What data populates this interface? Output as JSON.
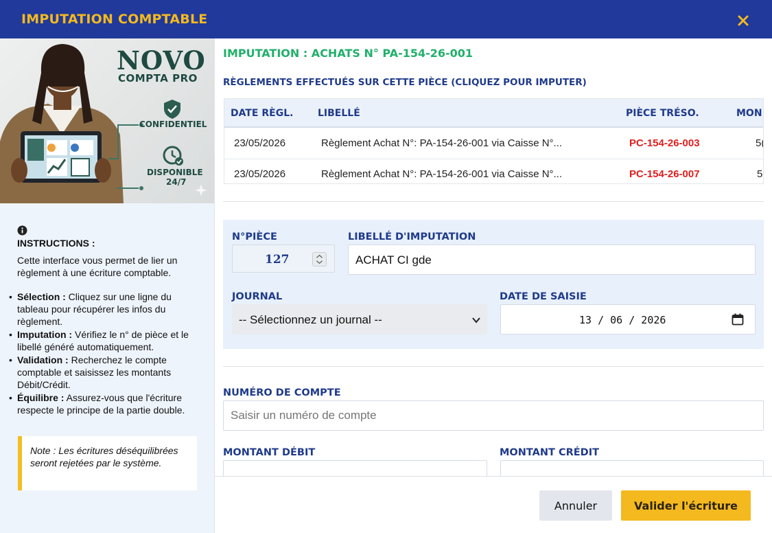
{
  "window": {
    "title": "IMPUTATION COMPTABLE"
  },
  "promo": {
    "brand_main": "NOVO",
    "brand_sub": "COMPTA PRO",
    "feature_1": "CONFIDENTIEL",
    "feature_2_line1": "DISPONIBLE",
    "feature_2_line2": "24/7"
  },
  "instructions": {
    "title": "INSTRUCTIONS :",
    "intro": "Cette interface vous permet de lier un règlement à une écriture comptable.",
    "items": [
      {
        "label": "Sélection :",
        "text": " Cliquez sur une ligne du tableau pour récupérer les infos du règlement."
      },
      {
        "label": "Imputation :",
        "text": " Vérifiez le n° de pièce et le libellé généré automatiquement."
      },
      {
        "label": "Validation :",
        "text": " Recherchez le compte comptable et saisissez les montants Débit/Crédit."
      },
      {
        "label": "Équilibre :",
        "text": " Assurez-vous que l'écriture respecte le principe de la partie double."
      }
    ],
    "note": "Note : Les écritures déséquilibrées seront rejetées par le système."
  },
  "imputation": {
    "title": "IMPUTATION : ACHATS N° PA-154-26-001",
    "reglements_title": "RÈGLEMENTS EFFECTUÉS SUR CETTE PIÈCE (CLIQUEZ POUR IMPUTER)",
    "columns": [
      "DATE RÈGL.",
      "LIBELLÉ",
      "PIÈCE TRÉSO.",
      "MON"
    ],
    "rows": [
      {
        "date": "23/05/2026",
        "libelle": "Règlement Achat N°: PA-154-26-001 via Caisse N°...",
        "piece": "PC-154-26-003",
        "montant": "5("
      },
      {
        "date": "23/05/2026",
        "libelle": "Règlement Achat N°: PA-154-26-001 via Caisse N°...",
        "piece": "PC-154-26-007",
        "montant": "5"
      }
    ]
  },
  "form": {
    "piece_label": "N°PIÈCE",
    "piece_value": "127",
    "libelle_label": "LIBELLÉ D'IMPUTATION",
    "libelle_value": "ACHAT CI gde",
    "journal_label": "JOURNAL",
    "journal_selected": "-- Sélectionnez un journal --",
    "date_label": "DATE DE SAISIE",
    "date_value": "13 / 06 / 2026",
    "compte_label": "NUMÉRO DE COMPTE",
    "compte_placeholder": "Saisir un numéro de compte",
    "debit_label": "MONTANT DÉBIT",
    "credit_label": "MONTANT CRÉDIT"
  },
  "footer": {
    "cancel_label": "Annuler",
    "validate_label": "Valider l'écriture"
  },
  "colors": {
    "header_bg": "#20399a",
    "header_title": "#f4b91f",
    "accent_green": "#20b06a",
    "label_blue": "#1f3a8a",
    "piece_red": "#e01e1e",
    "validate_btn": "#f4b91f"
  }
}
